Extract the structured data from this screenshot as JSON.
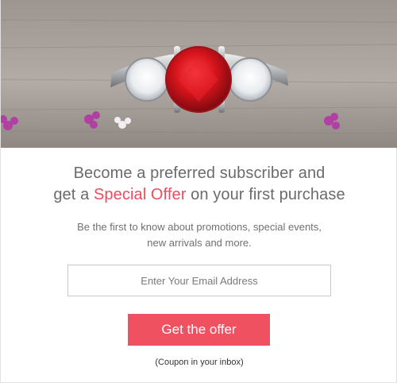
{
  "headline": {
    "line1": "Become a preferred subscriber and",
    "line2_prefix": "get a ",
    "line2_accent": "Special Offer",
    "line2_suffix": " on your first purchase"
  },
  "subtext": {
    "line1": "Be the first to know about promotions, special events,",
    "line2": "new arrivals and more."
  },
  "email_input": {
    "placeholder": "Enter Your Email Address",
    "value": ""
  },
  "cta_button": {
    "label": "Get the offer"
  },
  "note": "(Coupon in your inbox)",
  "colors": {
    "accent": "#ef4b5e",
    "button": "#ef5161",
    "text": "#6b6b6b"
  },
  "hero_image": {
    "subject": "ring-with-red-gemstone"
  }
}
